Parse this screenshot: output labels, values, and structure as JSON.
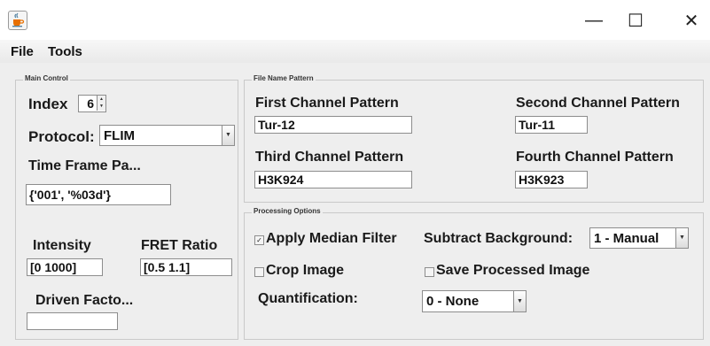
{
  "window": {
    "minimize_glyph": "—",
    "maximize_glyph": "☐",
    "close_glyph": "✕"
  },
  "menubar": {
    "file": "File",
    "tools": "Tools"
  },
  "main_control": {
    "legend": "Main Control",
    "index_label": "Index",
    "index_value": "6",
    "protocol_label": "Protocol:",
    "protocol_value": "FLIM",
    "time_frame_label": "Time Frame Pa...",
    "time_frame_value": "{'001', '%03d'}",
    "intensity_label": "Intensity",
    "intensity_value": "[0 1000]",
    "fret_label": "FRET Ratio",
    "fret_value": "[0.5 1.1]",
    "driven_label": "Driven Facto...",
    "driven_value": ""
  },
  "file_name_pattern": {
    "legend": "File Name Pattern",
    "first_label": "First Channel Pattern",
    "first_value": "Tur-12",
    "second_label": "Second Channel Pattern",
    "second_value": "Tur-11",
    "third_label": "Third Channel Pattern",
    "third_value": "H3K924",
    "fourth_label": "Fourth Channel Pattern",
    "fourth_value": "H3K923"
  },
  "processing": {
    "legend": "Processing Options",
    "median_label": "Apply Median Filter",
    "median_checked": true,
    "subtract_label": "Subtract Background:",
    "subtract_value": "1 - Manual",
    "crop_label": "Crop Image",
    "crop_checked": false,
    "save_label": "Save Processed Image",
    "save_checked": false,
    "quant_label": "Quantification:",
    "quant_value": "0 - None"
  },
  "icons": {
    "app": "java-coffee-cup-icon",
    "spinner": "spinner-arrows-icon",
    "dropdown": "chevron-down-icon",
    "check": "check-mark-icon"
  }
}
